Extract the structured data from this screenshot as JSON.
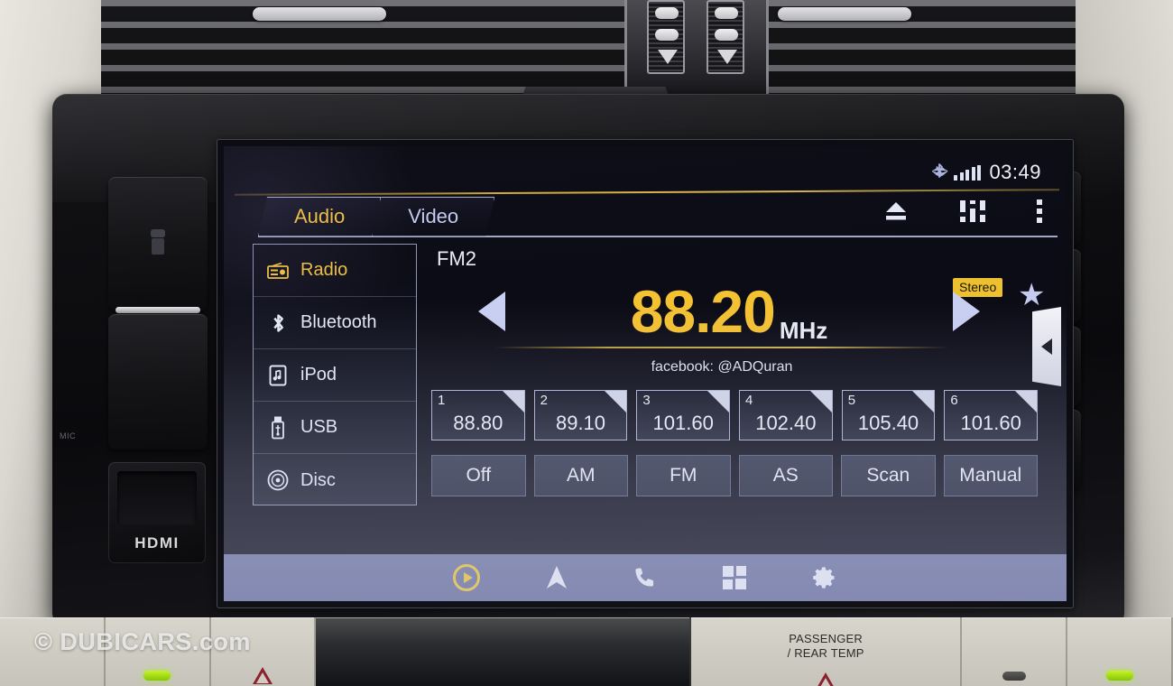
{
  "status": {
    "bluetooth_icon": "bluetooth-icon",
    "signal_icon": "signal-bars-icon",
    "time": "03:49"
  },
  "tabs": [
    {
      "label": "Audio",
      "active": true
    },
    {
      "label": "Video",
      "active": false
    }
  ],
  "top_icons": [
    {
      "name": "eject-icon"
    },
    {
      "name": "equalizer-icon"
    },
    {
      "name": "more-options-icon"
    }
  ],
  "sources": [
    {
      "label": "Radio",
      "icon": "radio-icon",
      "active": true
    },
    {
      "label": "Bluetooth",
      "icon": "bluetooth-icon",
      "active": false
    },
    {
      "label": "iPod",
      "icon": "ipod-icon",
      "active": false
    },
    {
      "label": "USB",
      "icon": "usb-icon",
      "active": false
    },
    {
      "label": "Disc",
      "icon": "disc-icon",
      "active": false
    }
  ],
  "tuner": {
    "band": "FM2",
    "frequency": "88.20",
    "unit": "MHz",
    "stereo_badge": "Stereo",
    "favorite_icon": "star-icon",
    "rds_text": "facebook: @ADQuran",
    "tune_down_icon": "arrow-left-icon",
    "tune_up_icon": "arrow-right-icon",
    "panel_handle_icon": "chevron-left-icon"
  },
  "presets": [
    {
      "number": "1",
      "value": "88.80"
    },
    {
      "number": "2",
      "value": "89.10"
    },
    {
      "number": "3",
      "value": "101.60"
    },
    {
      "number": "4",
      "value": "102.40"
    },
    {
      "number": "5",
      "value": "105.40"
    },
    {
      "number": "6",
      "value": "101.60"
    }
  ],
  "modes": [
    {
      "label": "Off"
    },
    {
      "label": "AM"
    },
    {
      "label": "FM"
    },
    {
      "label": "AS"
    },
    {
      "label": "Scan"
    },
    {
      "label": "Manual"
    }
  ],
  "nav": [
    {
      "name": "media-icon",
      "active": true
    },
    {
      "name": "navigation-icon",
      "active": false
    },
    {
      "name": "phone-icon",
      "active": false
    },
    {
      "name": "apps-icon",
      "active": false
    },
    {
      "name": "settings-icon",
      "active": false
    }
  ],
  "hardware": {
    "left_panel_label": "MIC",
    "hdmi_label": "HDMI",
    "right_buttons": [
      {
        "name": "power-button",
        "icon": "power-icon"
      },
      {
        "name": "back-home-button",
        "icon": "back-home-icon"
      },
      {
        "name": "volume-up-button",
        "icon": "plus-icon"
      },
      {
        "name": "volume-down-button",
        "icon": "minus-icon"
      }
    ]
  },
  "lower_dash": {
    "passenger_temp_label": "PASSENGER\n/ REAR TEMP",
    "passenger_temp_line1": "PASSENGER",
    "passenger_temp_line2": "/ REAR TEMP"
  },
  "watermark": "© DUBICARS.com",
  "colors": {
    "accent_yellow": "#f2c13c",
    "freq_yellow": "#f4c132",
    "ui_lavender": "#c9cff0",
    "nav_bar": "#7e84b4",
    "led_green": "#a8e61a"
  }
}
